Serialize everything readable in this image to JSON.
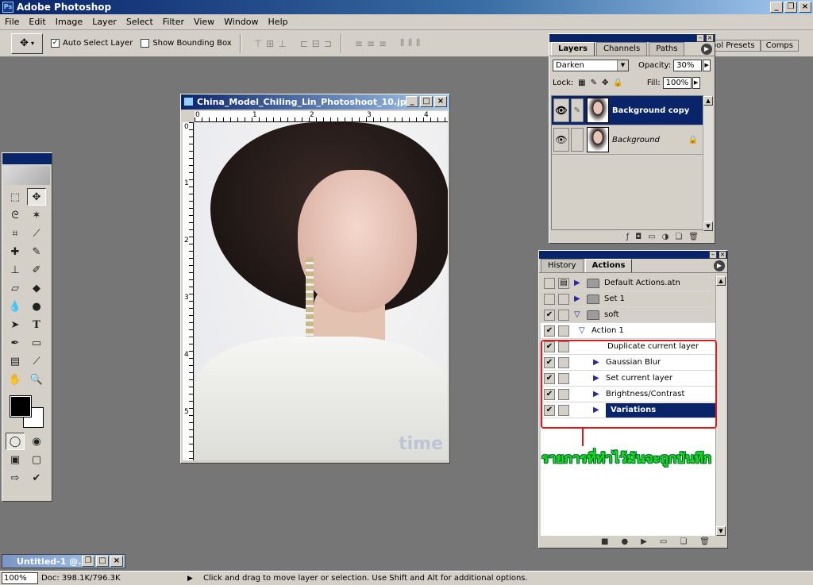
{
  "app": {
    "title": "Adobe Photoshop"
  },
  "menu": [
    "File",
    "Edit",
    "Image",
    "Layer",
    "Select",
    "Filter",
    "View",
    "Window",
    "Help"
  ],
  "options": {
    "auto_select": "Auto Select Layer",
    "show_bbox": "Show Bounding Box",
    "palette_well": [
      "ool Presets",
      "Comps"
    ]
  },
  "document": {
    "title": "China_Model_Chiling_Lin_Photoshoot_10.jp...",
    "hruler": [
      "0",
      "1",
      "2",
      "3",
      "4"
    ],
    "vruler": [
      "0",
      "1",
      "2",
      "3",
      "4",
      "5"
    ],
    "watermark": "time"
  },
  "layers": {
    "tabs": [
      "Layers",
      "Channels",
      "Paths"
    ],
    "blend_mode": "Darken",
    "opacity_label": "Opacity:",
    "opacity": "30%",
    "lock_label": "Lock:",
    "fill_label": "Fill:",
    "fill": "100%",
    "items": [
      {
        "name": "Background copy",
        "selected": true
      },
      {
        "name": "Background",
        "selected": false
      }
    ]
  },
  "actions": {
    "tabs": [
      "History",
      "Actions"
    ],
    "rows": [
      {
        "label": "Default Actions.atn",
        "type": "set"
      },
      {
        "label": "Set 1",
        "type": "set"
      },
      {
        "label": "soft",
        "type": "set-open"
      },
      {
        "label": "Action 1",
        "type": "action"
      },
      {
        "label": "Duplicate current layer",
        "type": "step"
      },
      {
        "label": "Gaussian Blur",
        "type": "step"
      },
      {
        "label": "Set current layer",
        "type": "step"
      },
      {
        "label": "Brightness/Contrast",
        "type": "step"
      },
      {
        "label": "Variations",
        "type": "step",
        "selected": true
      }
    ]
  },
  "annotation": "รายการที่ทำไว้มันจะถูกบันทึก",
  "minimized_doc": {
    "title": "Untitled-1 @..."
  },
  "status": {
    "zoom": "100%",
    "doc": "Doc: 398.1K/796.3K",
    "hint": "Click and drag to move layer or selection.  Use Shift and Alt for additional options."
  },
  "colors": {
    "title_blue": "#0a246a",
    "chrome": "#d4d0c8",
    "annotation_green": "#18e018",
    "annotation_red": "#e01818"
  }
}
